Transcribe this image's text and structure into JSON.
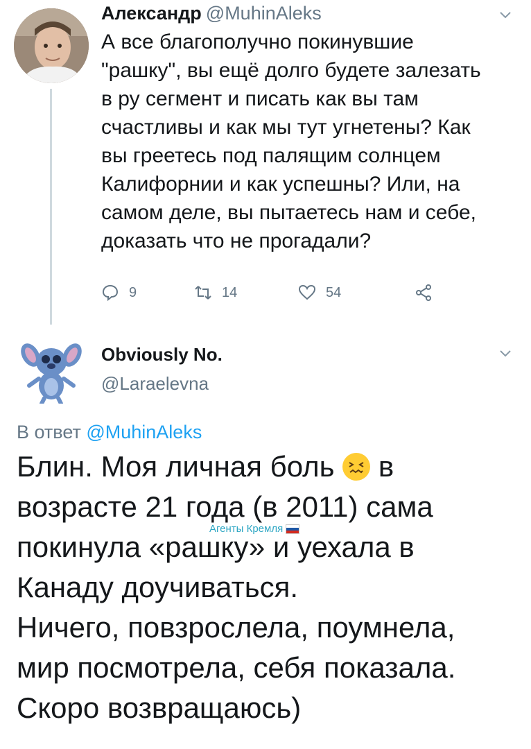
{
  "tweet1": {
    "name": "Александр",
    "handle": "@MuhinAleks",
    "lines": [
      "А все благополучно покинувшие",
      "\"рашку\", вы ещё долго будете залезать",
      "в ру сегмент и писать как вы там",
      "счастливы и как мы тут угнетены? Как",
      "вы греетесь под палящим солнцем",
      "Калифорнии и как успешны? Или, на",
      "самом деле, вы пытаетесь нам и себе,",
      "доказать что не прогадали?"
    ],
    "actions": {
      "reply_count": "9",
      "retweet_count": "14",
      "like_count": "54"
    }
  },
  "tweet2": {
    "name": "Obviously No.",
    "handle": "@Laraelevna",
    "reply_prefix": "В ответ",
    "reply_handle": "@MuhinAleks",
    "line1_before_emoji": "Блин. Моя личная боль",
    "line1_after_emoji": "в",
    "lines": [
      "возрасте 21 года (в 2011) сама",
      "покинула «рашку» и уехала в",
      "Канаду доучиваться.",
      "Ничего, повзрослела, поумнела,",
      "мир посмотрела, себя показала.",
      "Скоро возвращаюсь)"
    ],
    "emoji": "confounded-face"
  },
  "watermark": "Агенты Кремля",
  "colors": {
    "text": "#14171a",
    "secondary": "#657786",
    "link": "#1da1f2",
    "thread_line": "#cfd9de",
    "watermark": "#2fa7c4"
  },
  "icons": [
    "reply-icon",
    "retweet-icon",
    "like-icon",
    "share-icon",
    "chevron-down-icon"
  ]
}
